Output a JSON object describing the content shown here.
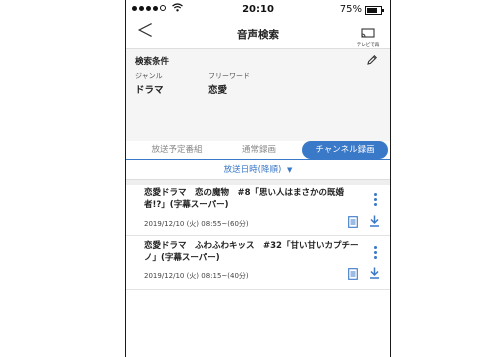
{
  "status_bar": {
    "time": "20:10",
    "battery_percent": "75%"
  },
  "navbar": {
    "back_label": "＜",
    "title": "音声検索",
    "cast_label": "テレビで再生"
  },
  "conditions": {
    "heading": "検索条件",
    "genre_label": "ジャンル",
    "genre_value": "ドラマ",
    "freeword_label": "フリーワード",
    "freeword_value": "恋愛"
  },
  "tabs": [
    {
      "label": "放送予定番組",
      "active": false
    },
    {
      "label": "通常録画",
      "active": false
    },
    {
      "label": "チャンネル録画",
      "active": true
    }
  ],
  "sort": {
    "label": "放送日時(降順)",
    "arrow": "▼"
  },
  "results": [
    {
      "title": "恋愛ドラマ　恋の魔物　#8「思い人はまさかの既婚者!?」(字幕スーパー)",
      "datetime": "2019/12/10 (火) 08:55~(60分)"
    },
    {
      "title": "恋愛ドラマ　ふわふわキッス　#32「甘い甘いカプチーノ」(字幕スーパー)",
      "datetime": "2019/12/10 (火) 08:15~(40分)"
    }
  ],
  "colors": {
    "accent": "#3a78c8",
    "panel_bg": "#f5f5f5"
  }
}
